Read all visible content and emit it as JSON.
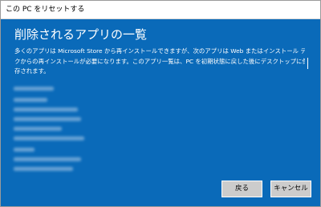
{
  "window": {
    "title": "この PC をリセットする"
  },
  "main": {
    "heading": "削除されるアプリの一覧",
    "description_lines": [
      "多くのアプリは Microsoft Store から再インストールできますが、次のアプリは Web またはインストール ディス",
      "クからの再インストールが必要になります。このアプリ一覧は、PC を初期状態に戻した後にデスクトップに保",
      "存されます。"
    ],
    "app_list_note": "app names are blurred in the screenshot"
  },
  "buttons": {
    "back_label": "戻る",
    "cancel_label": "キャンセル"
  },
  "colors": {
    "panel_background": "#0a6ab9",
    "text": "#ffffff",
    "button_background": "#cccccc"
  }
}
